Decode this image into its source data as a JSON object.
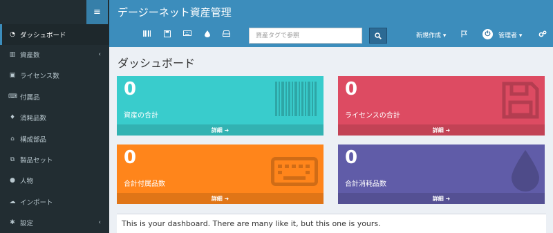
{
  "header": {
    "menu_toggle_icon": "hamburger-icon",
    "title": "デージーネット資産管理",
    "search_placeholder": "資産タグで参照",
    "new_label": "新規作成",
    "admin_label": "管理者",
    "caret": "▾",
    "nav_icons": [
      "barcode-icon",
      "save-icon",
      "keyboard-icon",
      "tint-icon",
      "hdd-icon"
    ]
  },
  "sidebar": {
    "items": [
      {
        "icon": "dashboard-icon",
        "label": "ダッシュボード",
        "active": true
      },
      {
        "icon": "barcode-icon",
        "label": "資産数",
        "chevron": "‹"
      },
      {
        "icon": "save-icon",
        "label": "ライセンス数"
      },
      {
        "icon": "keyboard-icon",
        "label": "付属品"
      },
      {
        "icon": "tint-icon",
        "label": "消耗品数"
      },
      {
        "icon": "hdd-icon",
        "label": "構成部品"
      },
      {
        "icon": "object-group-icon",
        "label": "製品セット"
      },
      {
        "icon": "users-icon",
        "label": "人物"
      },
      {
        "icon": "cloud-upload-icon",
        "label": "インポート"
      },
      {
        "icon": "cog-icon",
        "label": "設定",
        "chevron": "‹"
      }
    ]
  },
  "page_title": "ダッシュボード",
  "boxes": [
    {
      "count": "0",
      "label": "資産の合計",
      "footer": "詳細",
      "icon": "barcode-icon",
      "color": "#39cccc"
    },
    {
      "count": "0",
      "label": "ライセンスの合計",
      "footer": "詳細",
      "icon": "floppy-icon",
      "color": "#dd4b62"
    },
    {
      "count": "0",
      "label": "合計付属品数",
      "footer": "詳細",
      "icon": "keyboard-icon",
      "color": "#ff851b"
    },
    {
      "count": "0",
      "label": "合計消耗品数",
      "footer": "詳細",
      "icon": "tint-icon",
      "color": "#605ca8"
    }
  ],
  "message": "This is your dashboard. There are many like it, but this one is yours.",
  "colors": {
    "header": "#3c8dbc",
    "sidebar": "#222d32",
    "accent": "#367fa9"
  }
}
